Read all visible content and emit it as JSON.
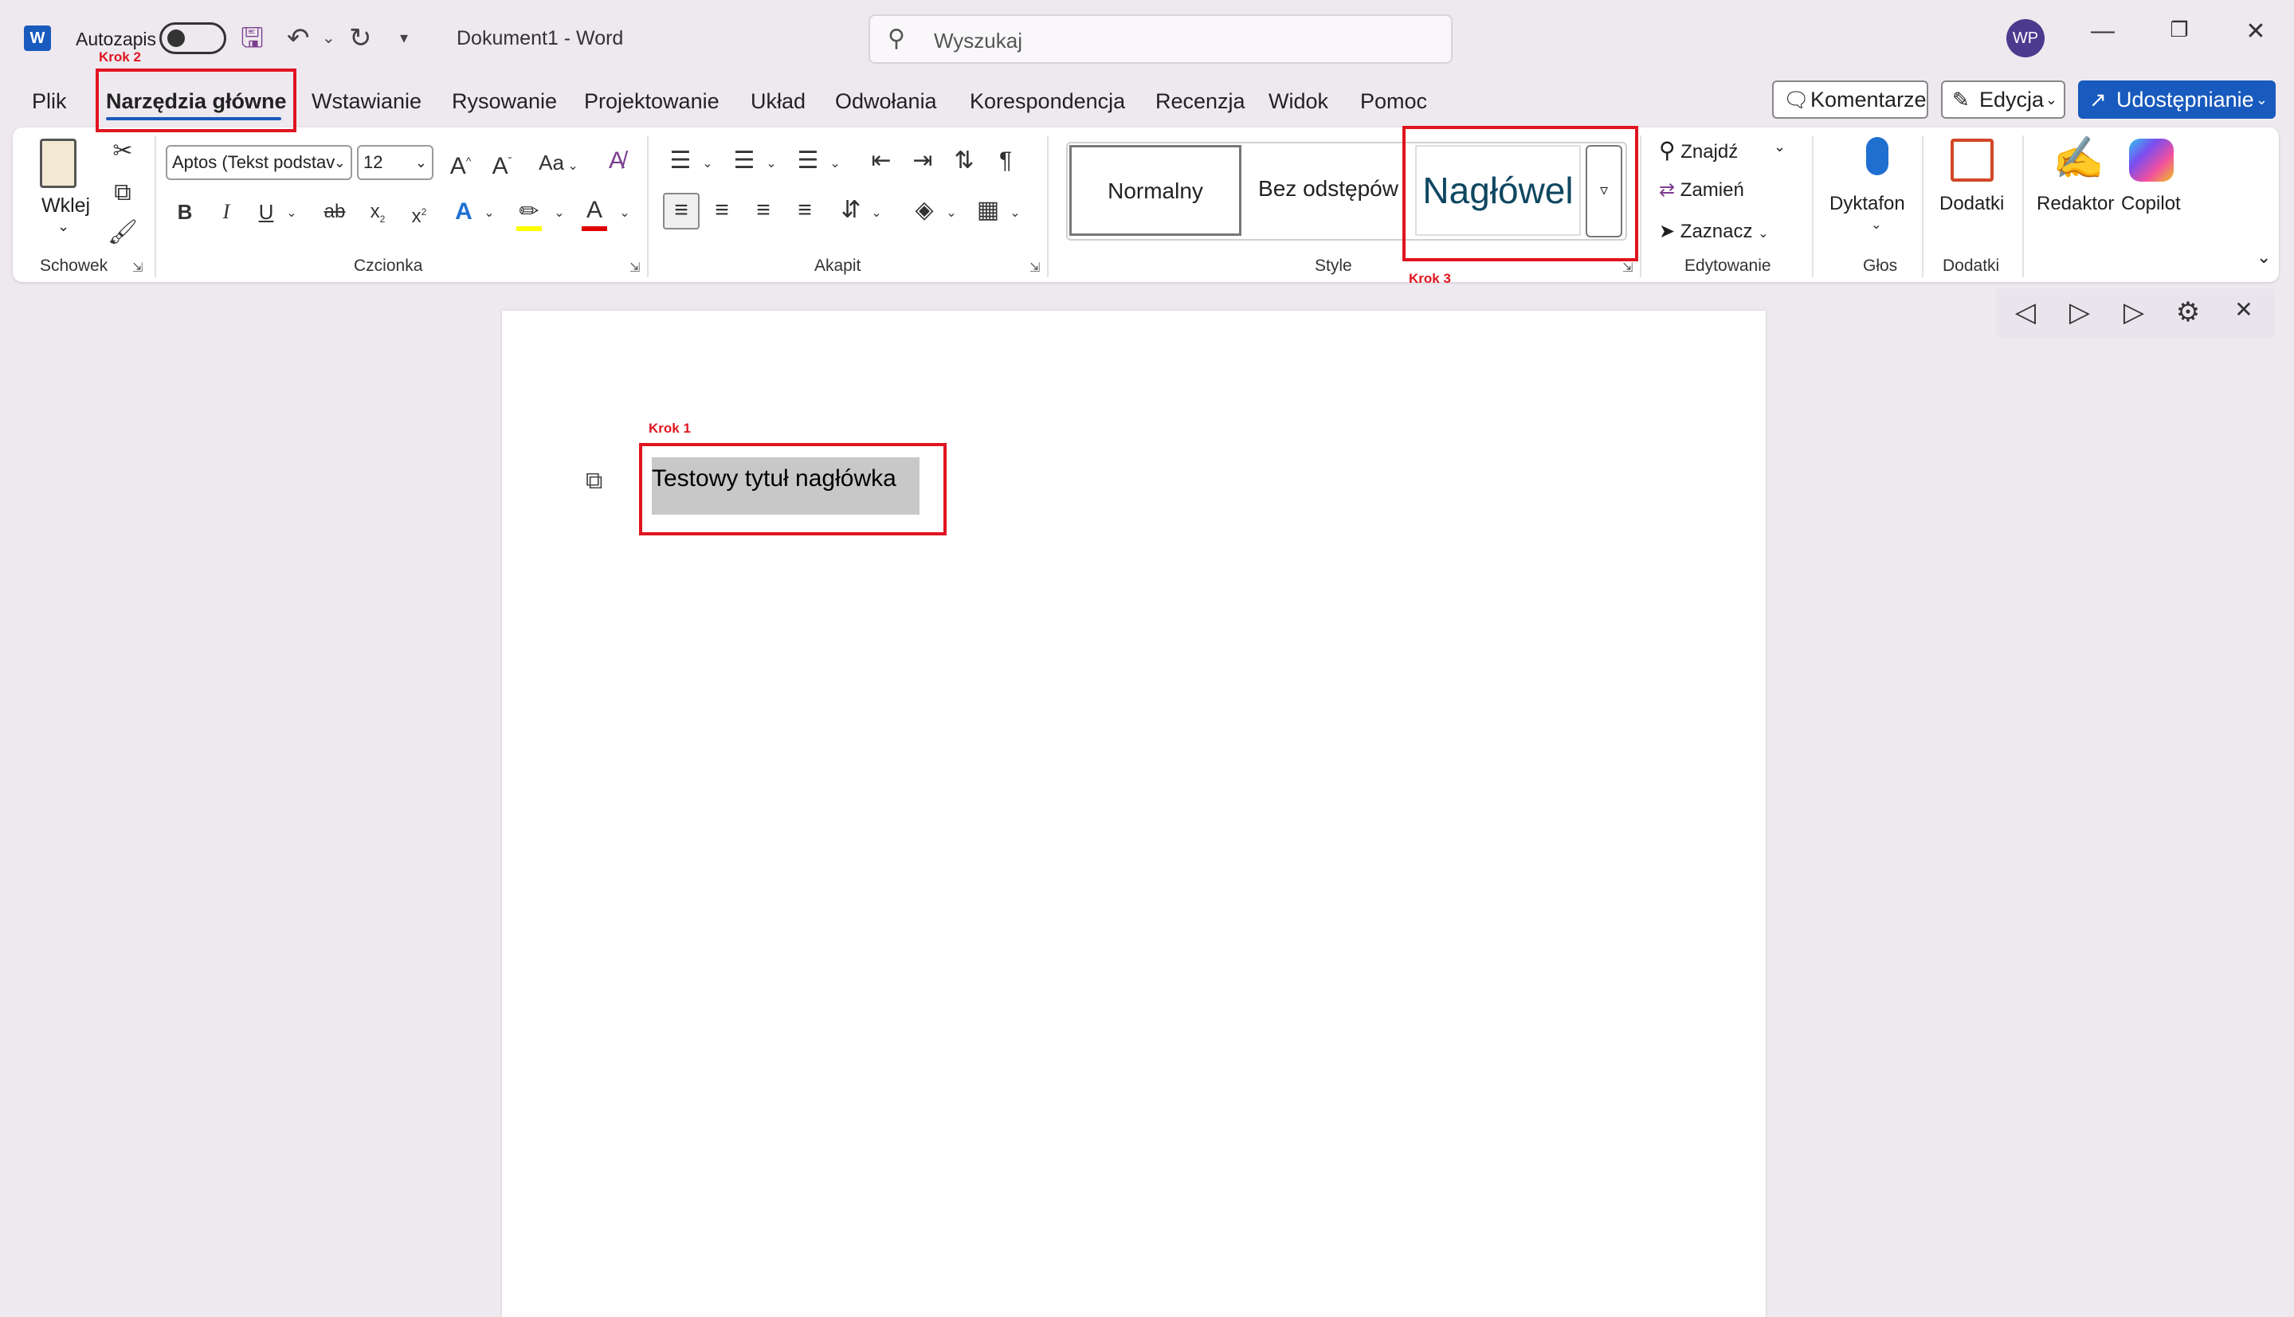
{
  "titlebar": {
    "app_letter": "W",
    "autosave_label": "Autozapis",
    "document_title": "Dokument1  -  Word",
    "search_placeholder": "Wyszukaj",
    "avatar_initials": "WP"
  },
  "tabs": [
    "Plik",
    "Narzędzia główne",
    "Wstawianie",
    "Rysowanie",
    "Projektowanie",
    "Układ",
    "Odwołania",
    "Korespondencja",
    "Recenzja",
    "Widok",
    "Pomoc"
  ],
  "header_buttons": {
    "comments": "Komentarze",
    "editing": "Edycja",
    "share": "Udostępnianie"
  },
  "ribbon": {
    "clipboard": {
      "paste": "Wklej",
      "label": "Schowek"
    },
    "font": {
      "name": "Aptos (Tekst podstav",
      "size": "12",
      "label": "Czcionka",
      "case_btn": "Aa"
    },
    "paragraph": {
      "label": "Akapit"
    },
    "styles": {
      "normal": "Normalny",
      "no_spacing": "Bez odstępów",
      "heading": "Nagłówel",
      "label": "Style"
    },
    "editing": {
      "find": "Znajdź",
      "replace": "Zamień",
      "select": "Zaznacz",
      "label": "Edytowanie"
    },
    "voice": {
      "dictate": "Dyktafon",
      "label": "Głos"
    },
    "addins": {
      "addins": "Dodatki",
      "label": "Dodatki"
    },
    "editor": "Redaktor",
    "copilot": "Copilot"
  },
  "document": {
    "heading_text": "Testowy tytuł nagłówka"
  },
  "annotations": {
    "step1": "Krok 1",
    "step2": "Krok 2",
    "step3": "Krok 3"
  },
  "colors": {
    "accent": "#185abd",
    "annotation": "#e0141f",
    "heading": "#0f4761",
    "highlight": "#ffff00",
    "font_color": "#e00000"
  }
}
